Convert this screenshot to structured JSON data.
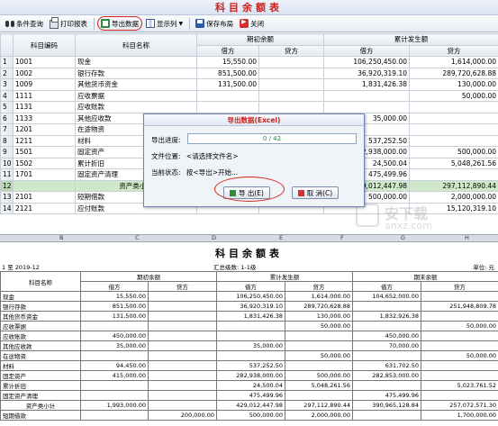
{
  "window_title": "科目余额表",
  "toolbar": [
    {
      "name": "conditional-query-button",
      "icon": "binoculars-icon",
      "label": "条件查询",
      "highlight": false
    },
    {
      "name": "print-report-button",
      "icon": "printer-icon",
      "label": "打印报表",
      "highlight": false
    },
    {
      "name": "export-data-button",
      "icon": "excel-export-icon",
      "label": "导出数据",
      "highlight": true
    },
    {
      "name": "show-columns-button",
      "icon": "columns-icon",
      "label": "显示列",
      "highlight": false,
      "caret": "▼"
    },
    {
      "name": "save-layout-button",
      "icon": "save-icon",
      "label": "保存布局",
      "highlight": false
    },
    {
      "name": "close-button",
      "icon": "close-icon",
      "label": "关闭",
      "highlight": false
    }
  ],
  "grid": {
    "headers": {
      "code": "科目编码",
      "name": "科目名称",
      "opening": "期初余额",
      "accum": "累计发生额",
      "debit": "借方",
      "credit": "贷方"
    },
    "rows": [
      {
        "n": "1",
        "code": "1001",
        "name": "现金",
        "od": "15,550.00",
        "oc": "",
        "ad": "106,250,450.00",
        "ac": "1,614,000.00"
      },
      {
        "n": "2",
        "code": "1002",
        "name": "银行存款",
        "od": "851,500.00",
        "oc": "",
        "ad": "36,920,319.10",
        "ac": "289,720,628.88"
      },
      {
        "n": "3",
        "code": "1009",
        "name": "其他货币资金",
        "od": "131,500.00",
        "oc": "",
        "ad": "1,831,426.38",
        "ac": "130,000.00"
      },
      {
        "n": "4",
        "code": "1111",
        "name": "应收票据",
        "od": "",
        "oc": "",
        "ad": "",
        "ac": "50,000.00"
      },
      {
        "n": "5",
        "code": "1131",
        "name": "应收账款",
        "od": "",
        "oc": "",
        "ad": "",
        "ac": ""
      },
      {
        "n": "6",
        "code": "1133",
        "name": "其他应收款",
        "od": "",
        "oc": "",
        "ad": "35,000.00",
        "ac": ""
      },
      {
        "n": "7",
        "code": "1201",
        "name": "在途物资",
        "od": "",
        "oc": "",
        "ad": "",
        "ac": ""
      },
      {
        "n": "8",
        "code": "1211",
        "name": "材料",
        "od": "",
        "oc": "",
        "ad": "537,252.50",
        "ac": ""
      },
      {
        "n": "9",
        "code": "1501",
        "name": "固定资产",
        "od": "",
        "oc": "",
        "ad": "282,938,000.00",
        "ac": "500,000.00"
      },
      {
        "n": "10",
        "code": "1502",
        "name": "累计折旧",
        "od": "",
        "oc": "",
        "ad": "24,500.04",
        "ac": "5,048,261.56"
      },
      {
        "n": "11",
        "code": "1701",
        "name": "固定资产清理",
        "od": "",
        "oc": "",
        "ad": "475,499.96",
        "ac": ""
      },
      {
        "n": "12",
        "code": "",
        "name": "资产类小计",
        "od": "",
        "oc": "",
        "ad": "429,012,447.98",
        "ac": "297,112,890.44",
        "hl": true
      },
      {
        "n": "13",
        "code": "2101",
        "name": "短期借款",
        "od": "",
        "oc": "200,000.00",
        "ad": "500,000.00",
        "ac": "2,000,000.00"
      },
      {
        "n": "14",
        "code": "2121",
        "name": "应付账款",
        "od": "",
        "oc": "",
        "ad": "",
        "ac": "15,120,319.10"
      }
    ]
  },
  "column_letters": [
    "B",
    "C",
    "D",
    "E",
    "F",
    "G",
    "H"
  ],
  "dialog": {
    "title": "导出数据(Excel)",
    "progress_label": "导出进度:",
    "progress_text": "0 / 42",
    "progress_fraction": 0.0,
    "file_label": "文件位置:",
    "file_value": "<请选择文件名>",
    "status_label": "当前状态:",
    "status_value": "按<导出>开始...",
    "export_btn": "导 出(E)",
    "cancel_btn": "取 消(C)"
  },
  "report": {
    "title": "科目余额表",
    "period": "1 至 2019-12",
    "summary_level": "汇总级数: 1-1级",
    "unit": "单位: 元",
    "headers": {
      "name": "科目名称",
      "opening": "期初余额",
      "accum": "累计发生额",
      "closing": "期末余额",
      "debit": "借方",
      "credit": "贷方"
    },
    "rows": [
      {
        "name": "现金",
        "od": "15,550.00",
        "oc": "",
        "ad": "106,250,450.00",
        "ac": "1,614,000.00",
        "cd": "104,652,000.00",
        "cc": ""
      },
      {
        "name": "银行存款",
        "od": "851,500.00",
        "oc": "",
        "ad": "36,920,319.10",
        "ac": "289,720,628.88",
        "cd": "",
        "cc": "251,948,809.78"
      },
      {
        "name": "其他货币资金",
        "od": "131,500.00",
        "oc": "",
        "ad": "1,831,426.38",
        "ac": "130,000.00",
        "cd": "1,832,926.38",
        "cc": ""
      },
      {
        "name": "应收票据",
        "od": "",
        "oc": "",
        "ad": "",
        "ac": "50,000.00",
        "cd": "",
        "cc": "50,000.00"
      },
      {
        "name": "应收账款",
        "od": "450,000.00",
        "oc": "",
        "ad": "",
        "ac": "",
        "cd": "450,000.00",
        "cc": ""
      },
      {
        "name": "其他应收款",
        "od": "35,000.00",
        "oc": "",
        "ad": "35,000.00",
        "ac": "",
        "cd": "70,000.00",
        "cc": ""
      },
      {
        "name": "在途物资",
        "od": "",
        "oc": "",
        "ad": "",
        "ac": "50,000.00",
        "cd": "",
        "cc": "50,000.00"
      },
      {
        "name": "材料",
        "od": "94,450.00",
        "oc": "",
        "ad": "537,252.50",
        "ac": "",
        "cd": "631,702.50",
        "cc": ""
      },
      {
        "name": "固定资产",
        "od": "415,000.00",
        "oc": "",
        "ad": "282,938,000.00",
        "ac": "500,000.00",
        "cd": "282,853,000.00",
        "cc": ""
      },
      {
        "name": "累计折旧",
        "od": "",
        "oc": "",
        "ad": "24,500.04",
        "ac": "5,048,261.56",
        "cd": "",
        "cc": "5,023,761.52"
      },
      {
        "name": "固定资产清理",
        "od": "",
        "oc": "",
        "ad": "475,499.96",
        "ac": "",
        "cd": "475,499.96",
        "cc": ""
      },
      {
        "name": "资产类小计",
        "od": "1,993,000.00",
        "oc": "",
        "ad": "429,012,447.98",
        "ac": "297,112,890.44",
        "cd": "390,965,128.84",
        "cc": "257,072,571.30",
        "center": true
      },
      {
        "name": "短期借款",
        "od": "",
        "oc": "200,000.00",
        "ad": "500,000.00",
        "ac": "2,000,000.00",
        "cd": "",
        "cc": "1,700,000.00"
      }
    ]
  },
  "watermark": {
    "t1": "安下载",
    "t2": "anxz.com"
  },
  "colors": {
    "title_red": "#c9201a",
    "highlight_red": "#d3231c",
    "subtotal_green": "#cfe8c9",
    "progress_text": "#2b8a4e"
  }
}
